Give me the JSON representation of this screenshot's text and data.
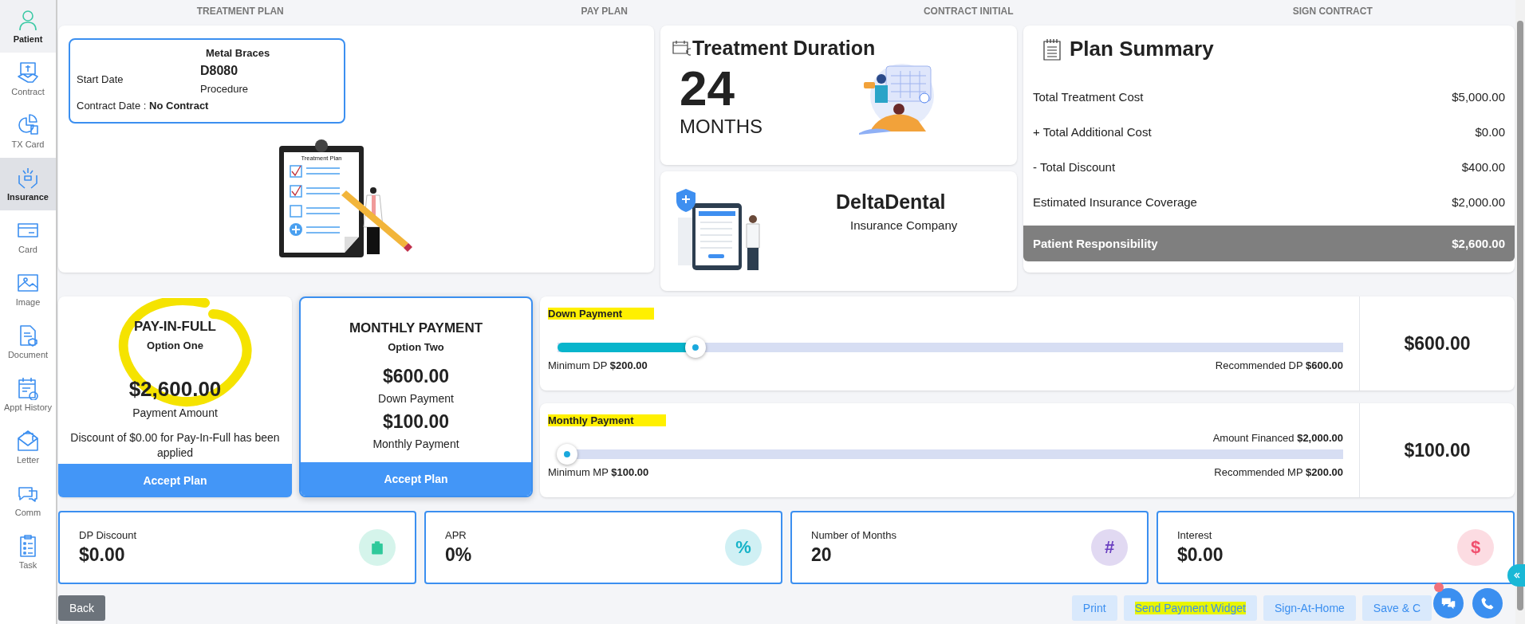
{
  "sidebar": {
    "items": [
      {
        "label": "Patient",
        "selected": true
      },
      {
        "label": "Contract",
        "selected": false
      },
      {
        "label": "TX Card",
        "selected": false
      },
      {
        "label": "Insurance",
        "selected": true
      },
      {
        "label": "Card",
        "selected": false
      },
      {
        "label": "Image",
        "selected": false
      },
      {
        "label": "Document",
        "selected": false
      },
      {
        "label": "Appt History",
        "selected": false
      },
      {
        "label": "Letter",
        "selected": false
      },
      {
        "label": "Comm",
        "selected": false
      },
      {
        "label": "Task",
        "selected": false
      }
    ]
  },
  "steps": [
    "TREATMENT PLAN",
    "PAY PLAN",
    "CONTRACT INITIAL",
    "SIGN CONTRACT"
  ],
  "treatment": {
    "title": "Metal Braces",
    "start_label": "Start Date",
    "code": "D8080",
    "code_label": "Procedure",
    "contract_label": "Contract Date :",
    "contract_value": "No Contract",
    "drawing_title": "Treatment Plan"
  },
  "duration": {
    "title": "Treatment Duration",
    "value": "24",
    "unit": "MONTHS"
  },
  "insurance": {
    "name": "DeltaDental",
    "label": "Insurance Company"
  },
  "summary": {
    "title": "Plan Summary",
    "rows": [
      {
        "label": "Total Treatment Cost",
        "value": "$5,000.00"
      },
      {
        "label": "+ Total Additional Cost",
        "value": "$0.00"
      },
      {
        "label": "- Total Discount",
        "value": "$400.00"
      },
      {
        "label": "Estimated Insurance Coverage",
        "value": "$2,000.00"
      }
    ],
    "total": {
      "label": "Patient Responsibility",
      "value": "$2,600.00"
    }
  },
  "options": [
    {
      "title": "PAY-IN-FULL",
      "subtitle": "Option One",
      "circled": true,
      "selected": false,
      "amounts": [
        {
          "value": "$2,600.00",
          "label": "Payment Amount"
        }
      ],
      "note": "Discount of $0.00 for Pay-In-Full has been applied",
      "button": "Accept Plan"
    },
    {
      "title": "MONTHLY PAYMENT",
      "subtitle": "Option Two",
      "circled": false,
      "selected": true,
      "amounts": [
        {
          "value": "$600.00",
          "label": "Down Payment"
        },
        {
          "value": "$100.00",
          "label": "Monthly Payment"
        }
      ],
      "button": "Accept Plan"
    }
  ],
  "sliders": [
    {
      "title": "Down Payment",
      "highlighted": true,
      "level": 0.176,
      "min_label": "Minimum DP",
      "min_value": "$200.00",
      "rec_label": "Recommended DP",
      "rec_value": "$600.00",
      "value": "$600.00"
    },
    {
      "title": "Monthly Payment",
      "highlighted": true,
      "level": 0.012,
      "extra_label": "Amount Financed",
      "extra_value": "$2,000.00",
      "min_label": "Minimum MP",
      "min_value": "$100.00",
      "rec_label": "Recommended MP",
      "rec_value": "$200.00",
      "value": "$100.00"
    }
  ],
  "stats": [
    {
      "label": "DP Discount",
      "value": "$0.00",
      "color": "#2fc99b"
    },
    {
      "label": "APR",
      "value": "0%",
      "glyph": "%",
      "color": "#16b3c8"
    },
    {
      "label": "Number of Months",
      "value": "20",
      "glyph": "#",
      "color": "#6a3fc0"
    },
    {
      "label": "Interest",
      "value": "$0.00",
      "glyph": "$",
      "color": "#f0506e"
    }
  ],
  "footer": {
    "back": "Back",
    "actions": [
      {
        "label": "Print",
        "highlighted": false
      },
      {
        "label": "Send Payment Widget",
        "highlighted": true
      },
      {
        "label": "Sign-At-Home",
        "highlighted": false
      },
      {
        "label": "Save & C",
        "highlighted": false
      }
    ]
  }
}
